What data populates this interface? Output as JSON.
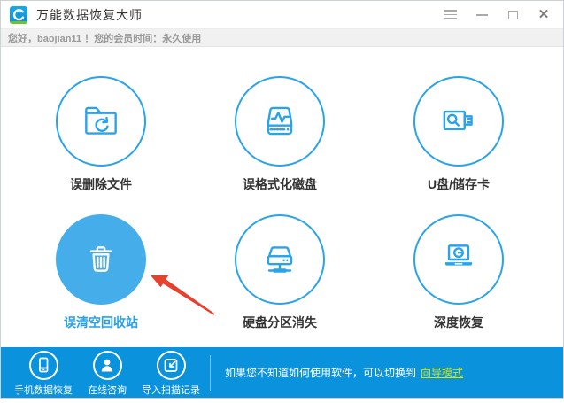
{
  "window": {
    "app_title": "万能数据恢复大师",
    "controls": [
      {
        "name": "menu"
      },
      {
        "name": "minimize"
      },
      {
        "name": "maximize"
      },
      {
        "name": "close",
        "glyph": "✕"
      }
    ]
  },
  "greeting": {
    "text": "您好，baojian11 ！您的会员时间：永久使用"
  },
  "features": [
    {
      "label": "误删除文件",
      "icon": "folder-recycle-icon",
      "selected": false
    },
    {
      "label": "误格式化磁盘",
      "icon": "disk-pulse-icon",
      "selected": false
    },
    {
      "label": "U盘/储存卡",
      "icon": "usb-search-icon",
      "selected": false
    },
    {
      "label": "误清空回收站",
      "icon": "trash-icon",
      "selected": true
    },
    {
      "label": "硬盘分区消失",
      "icon": "hdd-partition-icon",
      "selected": false
    },
    {
      "label": "深度恢复",
      "icon": "laptop-scan-icon",
      "selected": false
    }
  ],
  "annotation": {
    "type": "red-arrow",
    "points_to": "误清空回收站"
  },
  "footer": {
    "actions": [
      {
        "label": "手机数据恢复",
        "icon": "phone-icon"
      },
      {
        "label": "在线咨询",
        "icon": "person-icon"
      },
      {
        "label": "导入扫描记录",
        "icon": "import-icon"
      }
    ],
    "help_text": "如果您不知道如何使用软件，可以切换到",
    "help_link_label": "向导模式"
  },
  "colors": {
    "accent": "#2aa3e8",
    "selected_fill": "#45aeea",
    "footer_bg": "#0a93dc",
    "link": "#c9e71c",
    "arrow_red": "#e8402f"
  }
}
